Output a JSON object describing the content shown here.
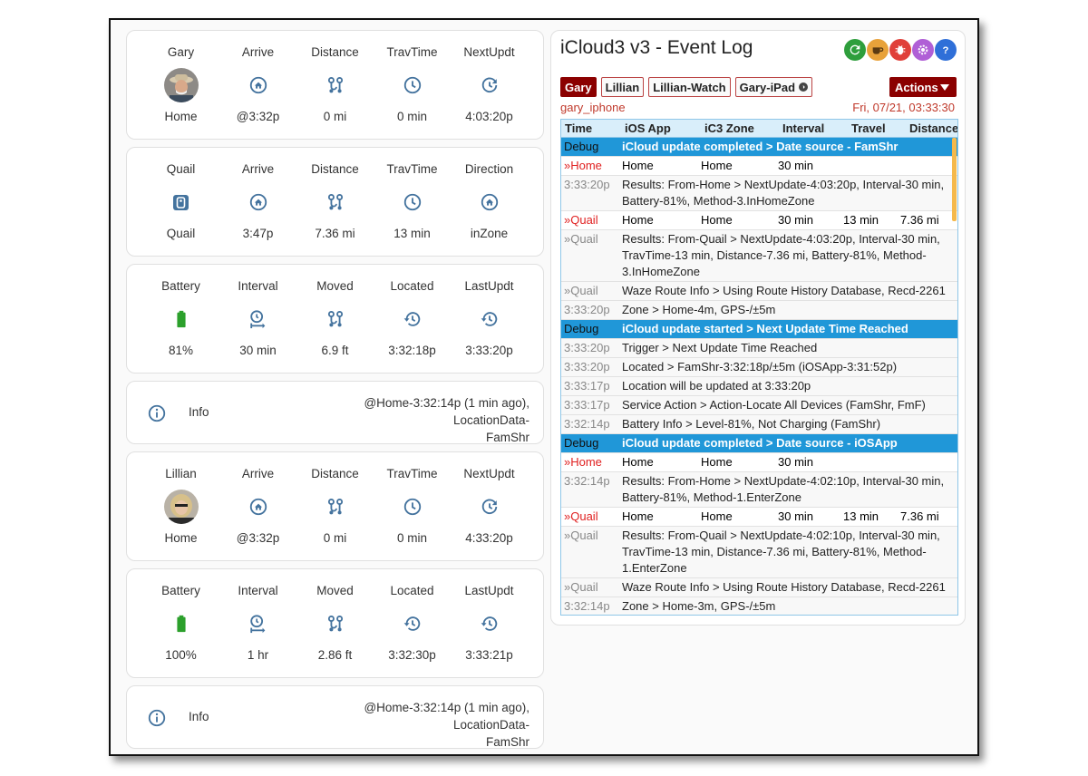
{
  "colors": {
    "icon_blue": "#44739e",
    "battery_green": "#2ca02c",
    "device_active_bg": "#8b0000",
    "log_header_bg": "#2097d8",
    "log_red": "#e02020"
  },
  "left": {
    "cards": [
      {
        "type": "stats",
        "cols": [
          {
            "label": "Gary",
            "icon": "avatar-gary",
            "value": "Home"
          },
          {
            "label": "Arrive",
            "icon": "home-icon",
            "value": "@3:32p"
          },
          {
            "label": "Distance",
            "icon": "route-icon",
            "value": "0 mi"
          },
          {
            "label": "TravTime",
            "icon": "clock-icon",
            "value": "0 min"
          },
          {
            "label": "NextUpdt",
            "icon": "refresh-clock-icon",
            "value": "4:03:20p"
          }
        ]
      },
      {
        "type": "stats",
        "cols": [
          {
            "label": "Quail",
            "icon": "zone-badge-icon",
            "value": "Quail"
          },
          {
            "label": "Arrive",
            "icon": "home-icon",
            "value": "3:47p"
          },
          {
            "label": "Distance",
            "icon": "route-icon",
            "value": "7.36 mi"
          },
          {
            "label": "TravTime",
            "icon": "clock-icon",
            "value": "13 min"
          },
          {
            "label": "Direction",
            "icon": "home-icon",
            "value": "inZone"
          }
        ]
      },
      {
        "type": "stats",
        "cols": [
          {
            "label": "Battery",
            "icon": "battery-icon",
            "value": "81%"
          },
          {
            "label": "Interval",
            "icon": "interval-timer-icon",
            "value": "30 min"
          },
          {
            "label": "Moved",
            "icon": "route-icon",
            "value": "6.9 ft"
          },
          {
            "label": "Located",
            "icon": "history-icon",
            "value": "3:32:18p"
          },
          {
            "label": "LastUpdt",
            "icon": "history-icon",
            "value": "3:33:20p"
          }
        ]
      },
      {
        "type": "info",
        "label": "Info",
        "line1": "@Home-3:32:14p (1 min ago), LocationData-",
        "line2": "FamShr"
      },
      {
        "type": "stats",
        "cols": [
          {
            "label": "Lillian",
            "icon": "avatar-lillian",
            "value": "Home"
          },
          {
            "label": "Arrive",
            "icon": "home-icon",
            "value": "@3:32p"
          },
          {
            "label": "Distance",
            "icon": "route-icon",
            "value": "0 mi"
          },
          {
            "label": "TravTime",
            "icon": "clock-icon",
            "value": "0 min"
          },
          {
            "label": "NextUpdt",
            "icon": "refresh-clock-icon",
            "value": "4:33:20p"
          }
        ]
      },
      {
        "type": "stats",
        "cols": [
          {
            "label": "Battery",
            "icon": "battery-icon",
            "value": "100%"
          },
          {
            "label": "Interval",
            "icon": "interval-timer-icon",
            "value": "1 hr"
          },
          {
            "label": "Moved",
            "icon": "route-icon",
            "value": "2.86 ft"
          },
          {
            "label": "Located",
            "icon": "history-icon",
            "value": "3:32:30p"
          },
          {
            "label": "LastUpdt",
            "icon": "history-icon",
            "value": "3:33:21p"
          }
        ]
      },
      {
        "type": "info",
        "label": "Info",
        "line1": "@Home-3:32:14p (1 min ago), LocationData-",
        "line2": "FamShr"
      }
    ]
  },
  "eventlog": {
    "title": "iCloud3 v3 - Event Log",
    "header_icons": [
      "refresh-icon",
      "coffee-icon",
      "bug-icon",
      "settings-icon",
      "help-icon"
    ],
    "devices": [
      "Gary",
      "Lillian",
      "Lillian-Watch",
      "Gary-iPad"
    ],
    "actions_label": "Actions",
    "device_name": "gary_iphone",
    "datetime": "Fri, 07/21, 03:33:30",
    "columns": [
      "Time",
      "iOS App",
      "iC3 Zone",
      "Interval",
      "Travel",
      "Distance"
    ],
    "rows": [
      {
        "kind": "hdr",
        "time": "Debug",
        "text": "iCloud update completed > Date source - FamShr"
      },
      {
        "kind": "red",
        "time": "»Home",
        "zone": "Home",
        "ic3": "Home",
        "interval": "30 min",
        "travel": "",
        "distance": ""
      },
      {
        "kind": "text",
        "time": "3:33:20p",
        "text": "Results: From-Home > NextUpdate-4:03:20p, Interval-30 min, Battery-81%, Method-3.InHomeZone"
      },
      {
        "kind": "red",
        "time": "»Quail",
        "zone": "Home",
        "ic3": "Home",
        "interval": "30 min",
        "travel": "13 min",
        "distance": "7.36 mi"
      },
      {
        "kind": "text",
        "time": "»Quail",
        "text": "Results: From-Quail > NextUpdate-4:03:20p, Interval-30 min, TravTime-13 min, Distance-7.36 mi, Battery-81%, Method-3.InHomeZone"
      },
      {
        "kind": "text",
        "time": "»Quail",
        "text": "Waze Route Info > Using Route History Database, Recd-2261"
      },
      {
        "kind": "text",
        "time": "3:33:20p",
        "text": "Zone > Home-4m, GPS-/±5m"
      },
      {
        "kind": "hdr",
        "time": "Debug",
        "text": "iCloud update started > Next Update Time Reached"
      },
      {
        "kind": "text",
        "time": "3:33:20p",
        "text": "Trigger > Next Update Time Reached"
      },
      {
        "kind": "text",
        "time": "3:33:20p",
        "text": "Located > FamShr-3:32:18p/±5m (iOSApp-3:31:52p)"
      },
      {
        "kind": "text",
        "time": "3:33:17p",
        "text": "Location will be updated at 3:33:20p"
      },
      {
        "kind": "text",
        "time": "3:33:17p",
        "text": "Service Action > Action-Locate All Devices (FamShr, FmF)"
      },
      {
        "kind": "text",
        "time": "3:32:14p",
        "text": "Battery Info > Level-81%, Not Charging (FamShr)"
      },
      {
        "kind": "hdr",
        "time": "Debug",
        "text": "iCloud update completed > Date source - iOSApp"
      },
      {
        "kind": "red",
        "time": "»Home",
        "zone": "Home",
        "ic3": "Home",
        "interval": "30 min",
        "travel": "",
        "distance": ""
      },
      {
        "kind": "text",
        "time": "3:32:14p",
        "text": "Results: From-Home > NextUpdate-4:02:10p, Interval-30 min, Battery-81%, Method-1.EnterZone"
      },
      {
        "kind": "red",
        "time": "»Quail",
        "zone": "Home",
        "ic3": "Home",
        "interval": "30 min",
        "travel": "13 min",
        "distance": "7.36 mi"
      },
      {
        "kind": "text",
        "time": "»Quail",
        "text": "Results: From-Quail > NextUpdate-4:02:10p, Interval-30 min, TravTime-13 min, Distance-7.36 mi, Battery-81%, Method-1.EnterZone"
      },
      {
        "kind": "text",
        "time": "»Quail",
        "text": "Waze Route Info > Using Route History Database, Recd-2261"
      },
      {
        "kind": "text",
        "time": "3:32:14p",
        "text": "Zone > Home-3m, GPS-/±5m"
      }
    ]
  }
}
